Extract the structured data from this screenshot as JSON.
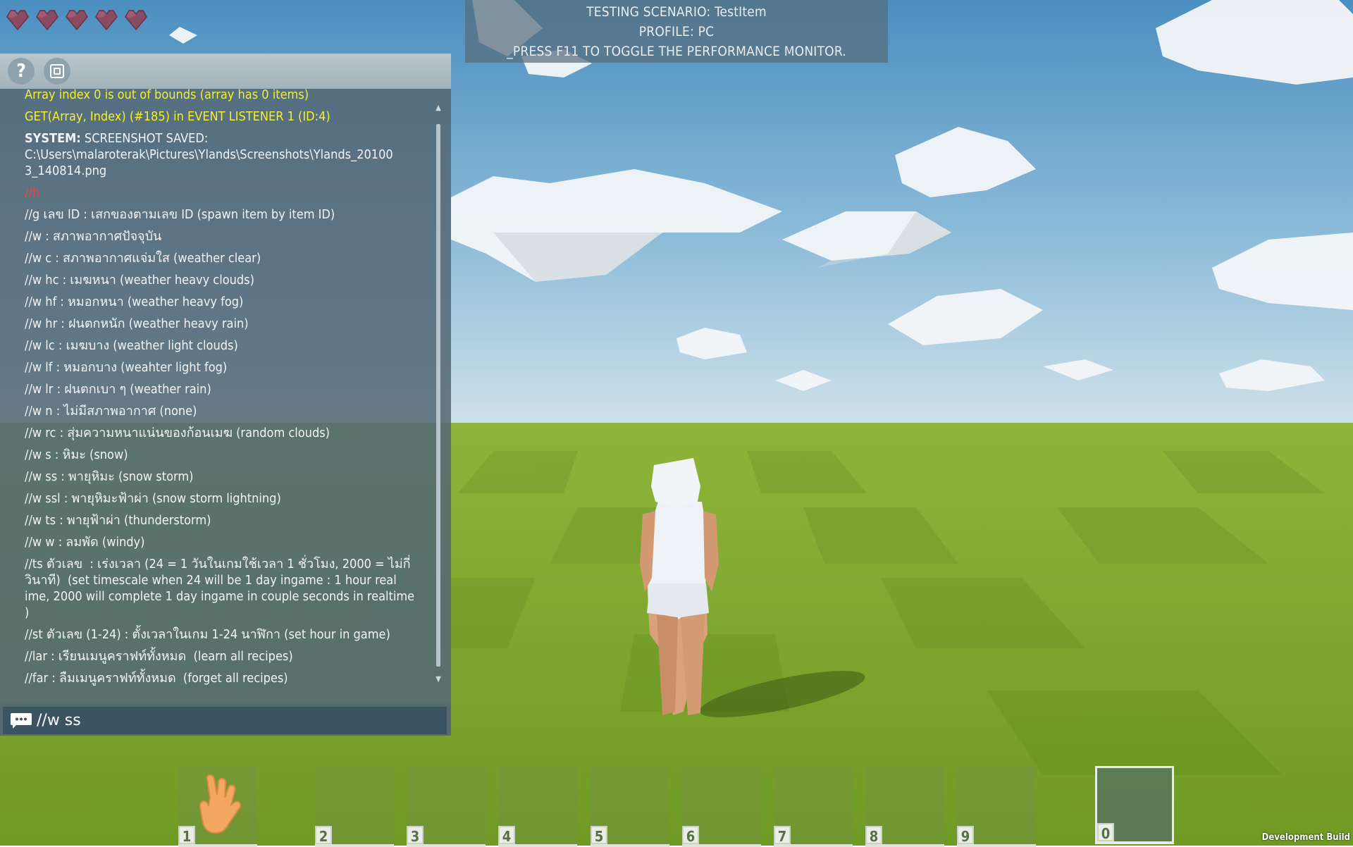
{
  "hud": {
    "hearts": [
      true,
      true,
      true,
      true,
      true
    ],
    "heart_color": "#8a4a62"
  },
  "info_panel": {
    "scenario_line": "TESTING SCENARIO: TestItem",
    "profile_line": "PROFILE: PC",
    "hint_line": "_PRESS F11 TO TOGGLE THE PERFORMANCE MONITOR."
  },
  "console": {
    "help_label": "?",
    "help_icon": "question-mark-icon",
    "screenshot_icon": "screenshot-icon",
    "lines": [
      {
        "style": "y",
        "text": "Array index 0 is out of bounds (array has 0 items)"
      },
      {
        "style": "y",
        "text": "GET(Array, Index) (#185) in EVENT LISTENER 1 (ID:4)"
      },
      {
        "style": "sys",
        "label": "SYSTEM:",
        "text": " SCREENSHOT SAVED:\nC:\\Users\\malaroterak\\Pictures\\Ylands\\Screenshots\\Ylands_20100\n3_140814.png"
      },
      {
        "style": "r",
        "text": "//h"
      },
      {
        "style": "n",
        "text": "//g เลข ID : เสกของตามเลข ID (spawn item by item ID)"
      },
      {
        "style": "n",
        "text": "//w : สภาพอากาศปัจจุบัน"
      },
      {
        "style": "n",
        "text": "//w c : สภาพอากาศแจ่มใส (weather clear)"
      },
      {
        "style": "n",
        "text": "//w hc : เมฆหนา (weather heavy clouds)"
      },
      {
        "style": "n",
        "text": "//w hf : หมอกหนา (weather heavy fog)"
      },
      {
        "style": "n",
        "text": "//w hr : ฝนตกหนัก (weather heavy rain)"
      },
      {
        "style": "n",
        "text": "//w lc : เมฆบาง (weather light clouds)"
      },
      {
        "style": "n",
        "text": "//w lf : หมอกบาง (weahter light fog)"
      },
      {
        "style": "n",
        "text": "//w lr : ฝนตกเบา ๆ (weather rain)"
      },
      {
        "style": "n",
        "text": "//w n : ไม่มีสภาพอากาศ (none)"
      },
      {
        "style": "n",
        "text": "//w rc : สุ่มความหนาแน่นของก้อนเมฆ (random clouds)"
      },
      {
        "style": "n",
        "text": "//w s : หิมะ (snow)"
      },
      {
        "style": "n",
        "text": "//w ss : พายุหิมะ (snow storm)"
      },
      {
        "style": "n",
        "text": "//w ssl : พายุหิมะฟ้าผ่า (snow storm lightning)"
      },
      {
        "style": "n",
        "text": "//w ts : พายุฟ้าผ่า (thunderstorm)"
      },
      {
        "style": "n",
        "text": "//w w : ลมพัด (windy)"
      },
      {
        "style": "n",
        "text": "//ts ตัวเลข  : เร่งเวลา (24 = 1 วันในเกมใช้เวลา 1 ชั่วโมง, 2000 = ไม่กี่วินาที)  (set timescale when 24 will be 1 day ingame : 1 hour real ime, 2000 will complete 1 day ingame in couple seconds in realtime )"
      },
      {
        "style": "n",
        "text": "//st ตัวเลข (1-24) : ตั้งเวลาในเกม 1-24 นาฬิกา (set hour in game)"
      },
      {
        "style": "n",
        "text": "//lar : เรียนเมนูคราฟท์ทั้งหมด  (learn all recipes)"
      },
      {
        "style": "n",
        "text": "//far : ลืมเมนูคราฟท์ทั้งหมด  (forget all recipes)"
      }
    ],
    "input_value": "//w ss",
    "chat_icon": "chat-bubble-icon"
  },
  "hotbar": {
    "slots": [
      "1",
      "2",
      "3",
      "4",
      "5",
      "6",
      "7",
      "8",
      "9",
      "0"
    ],
    "selected": "0",
    "slot1_item": "hand-icon"
  },
  "footer": {
    "dev_build": "Development Build"
  }
}
